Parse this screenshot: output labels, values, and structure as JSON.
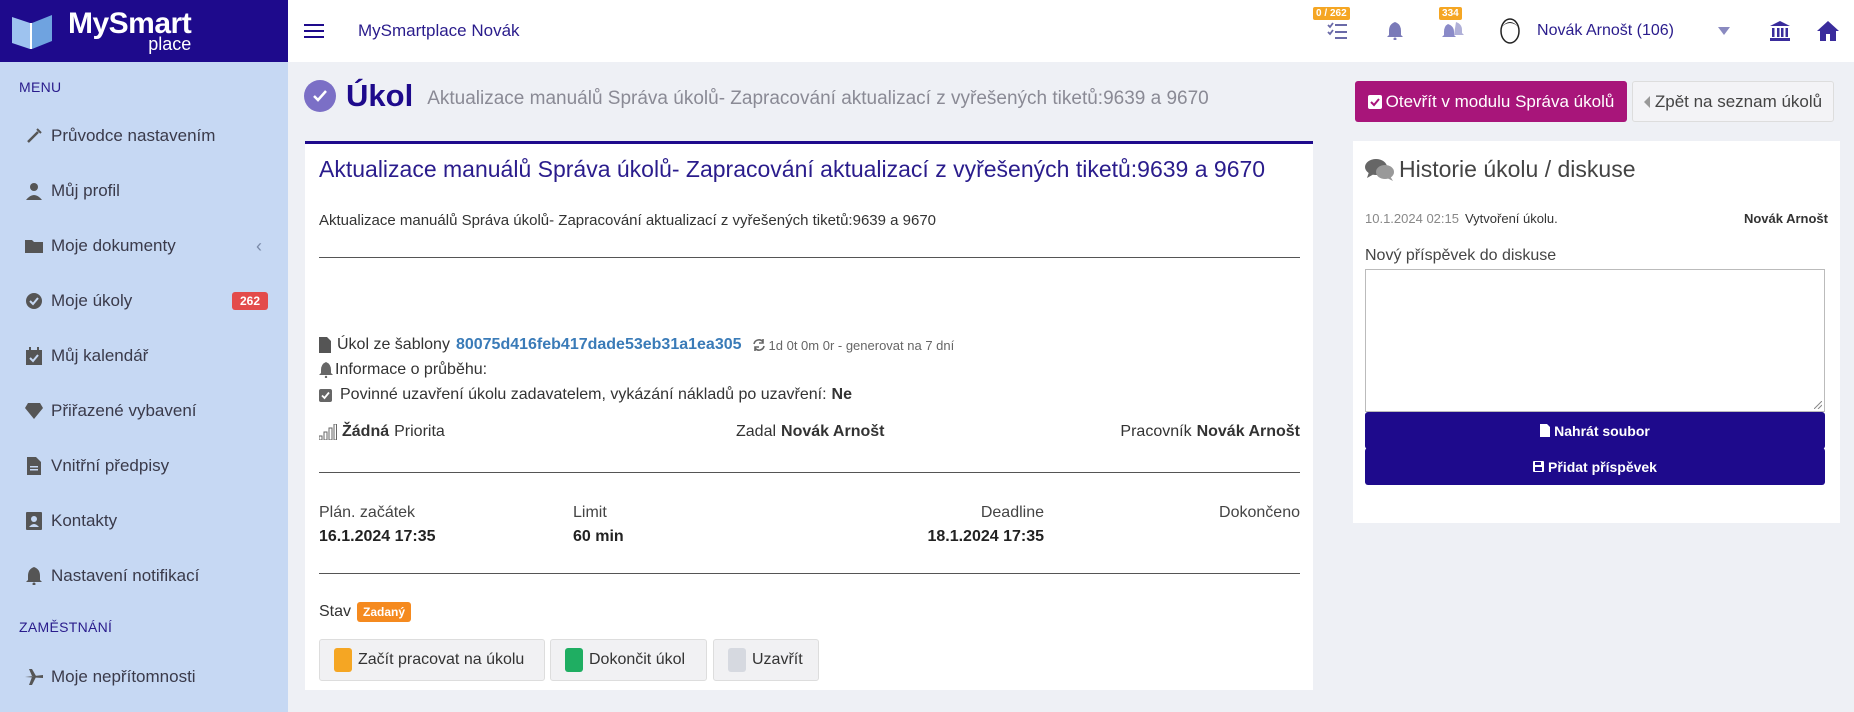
{
  "brand": {
    "line1": "MySmart",
    "line2": "place"
  },
  "topbar": {
    "title": "MySmartplace Novák",
    "tasks_badge": "0 / 262",
    "notif_badge": "334",
    "user": "Novák Arnošt (106)"
  },
  "sidebar": {
    "menu_label": "MENU",
    "employees_label": "ZAMĚSTNÁNÍ",
    "items": [
      {
        "label": "Průvodce nastavením",
        "icon": "wand-icon"
      },
      {
        "label": "Můj profil",
        "icon": "user-icon"
      },
      {
        "label": "Moje dokumenty",
        "icon": "folder-icon"
      },
      {
        "label": "Moje úkoly",
        "icon": "check-circle-icon",
        "badge": "262"
      },
      {
        "label": "Můj kalendář",
        "icon": "calendar-icon"
      },
      {
        "label": "Přiřazené vybavení",
        "icon": "diamond-icon"
      },
      {
        "label": "Vnitřní předpisy",
        "icon": "document-icon"
      },
      {
        "label": "Kontakty",
        "icon": "contact-icon"
      },
      {
        "label": "Nastavení notifikací",
        "icon": "bell-icon"
      },
      {
        "label": "Moje nepřítomnosti",
        "icon": "plane-icon"
      }
    ]
  },
  "page": {
    "title": "Úkol",
    "subtitle": "Aktualizace manuálů Správa úkolů- Zapracování aktualizací z vyřešených tiketů:9639 a 9670",
    "open_button": "Otevřít v modulu Správa úkolů",
    "back_button": "Zpět na seznam úkolů"
  },
  "task": {
    "title": "Aktualizace manuálů Správa úkolů- Zapracování aktualizací z vyřešených tiketů:9639 a 9670",
    "description": "Aktualizace manuálů Správa úkolů- Zapracování aktualizací z vyřešených tiketů:9639 a 9670",
    "template_label": "Úkol ze šablony",
    "template_hash": "80075d416feb417dade53eb31a1ea305",
    "recurrence": "1d 0t 0m 0r - generovat na 7 dní",
    "progress_info": "Informace o průběhu:",
    "closure_label": "Povinné uzavření úkolu zadavatelem, vykázání nákladů po uzavření:",
    "closure_value": "Ne",
    "priority_value": "Žádná",
    "priority_label": "Priorita",
    "assigner_label": "Zadal",
    "assigner": "Novák Arnošt",
    "worker_label": "Pracovník",
    "worker": "Novák Arnošt",
    "plan_start_label": "Plán. začátek",
    "plan_start": "16.1.2024 17:35",
    "limit_label": "Limit",
    "limit": "60 min",
    "deadline_label": "Deadline",
    "deadline": "18.1.2024 17:35",
    "done_label": "Dokončeno",
    "state_label": "Stav",
    "state": "Zadaný",
    "btn_start": "Začít pracovat na úkolu",
    "btn_finish": "Dokončit úkol",
    "btn_close": "Uzavřít"
  },
  "history": {
    "title": "Historie úkolu / diskuse",
    "entry_date": "10.1.2024 02:15",
    "entry_text": "Vytvoření úkolu.",
    "entry_author": "Novák Arnošt",
    "new_post_label": "Nový příspěvek do diskuse",
    "upload_button": "Nahrát soubor",
    "add_button": "Přidat příspěvek"
  },
  "colors": {
    "brand": "#1e0a8c",
    "accent": "#a8157a",
    "sidebar_bg": "#c6d8f3",
    "badge_red": "#e34b4b",
    "state_orange": "#f58a1f",
    "link": "#3a7bb8"
  }
}
